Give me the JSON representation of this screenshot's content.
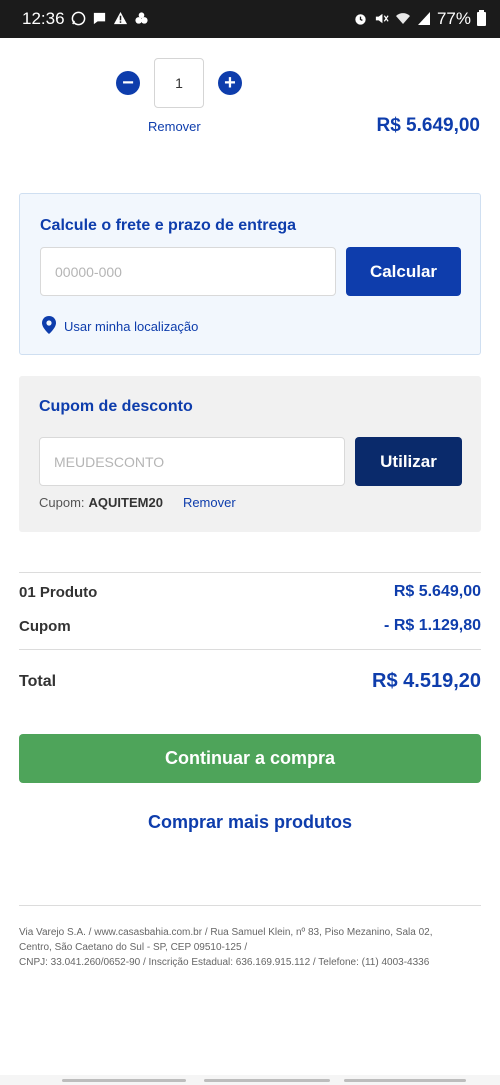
{
  "status_bar": {
    "time": "12:36",
    "battery": "77%",
    "left_icons": [
      "whatsapp-icon",
      "message-icon",
      "alert-icon",
      "app-icon"
    ],
    "right_icons": [
      "alarm-icon",
      "mute-icon",
      "wifi-icon",
      "signal-icon",
      "battery-icon"
    ]
  },
  "cart_item": {
    "quantity": "1",
    "remove_label": "Remover",
    "price": "R$ 5.649,00"
  },
  "shipping": {
    "title": "Calcule o frete e prazo de entrega",
    "cep_placeholder": "00000-000",
    "calculate_label": "Calcular",
    "use_location_label": "Usar minha localização"
  },
  "coupon": {
    "title": "Cupom de desconto",
    "input_placeholder": "MEUDESCONTO",
    "apply_label": "Utilizar",
    "applied_prefix": "Cupom:",
    "applied_code": "AQUITEM20",
    "remove_label": "Remover"
  },
  "summary": {
    "products_label": "01 Produto",
    "products_value": "R$ 5.649,00",
    "coupon_label": "Cupom",
    "coupon_value": "- R$ 1.129,80",
    "total_label": "Total",
    "total_value": "R$ 4.519,20"
  },
  "actions": {
    "continue_label": "Continuar a compra",
    "more_products_label": "Comprar mais produtos"
  },
  "footer": {
    "line1": "Via Varejo S.A. / www.casasbahia.com.br / Rua Samuel Klein, nº 83, Piso Mezanino, Sala 02,",
    "line2": "Centro, São Caetano do Sul - SP, CEP 09510-125 /",
    "line3": "CNPJ: 33.041.260/0652-90 / Inscrição Estadual: 636.169.915.112 / Telefone: (11) 4003-4336"
  },
  "colors": {
    "primary_blue": "#0e3dac",
    "dark_blue": "#0a2a6b",
    "green": "#4ea45a",
    "shipping_bg": "#f2f7fd",
    "coupon_bg": "#f1f1f1"
  }
}
